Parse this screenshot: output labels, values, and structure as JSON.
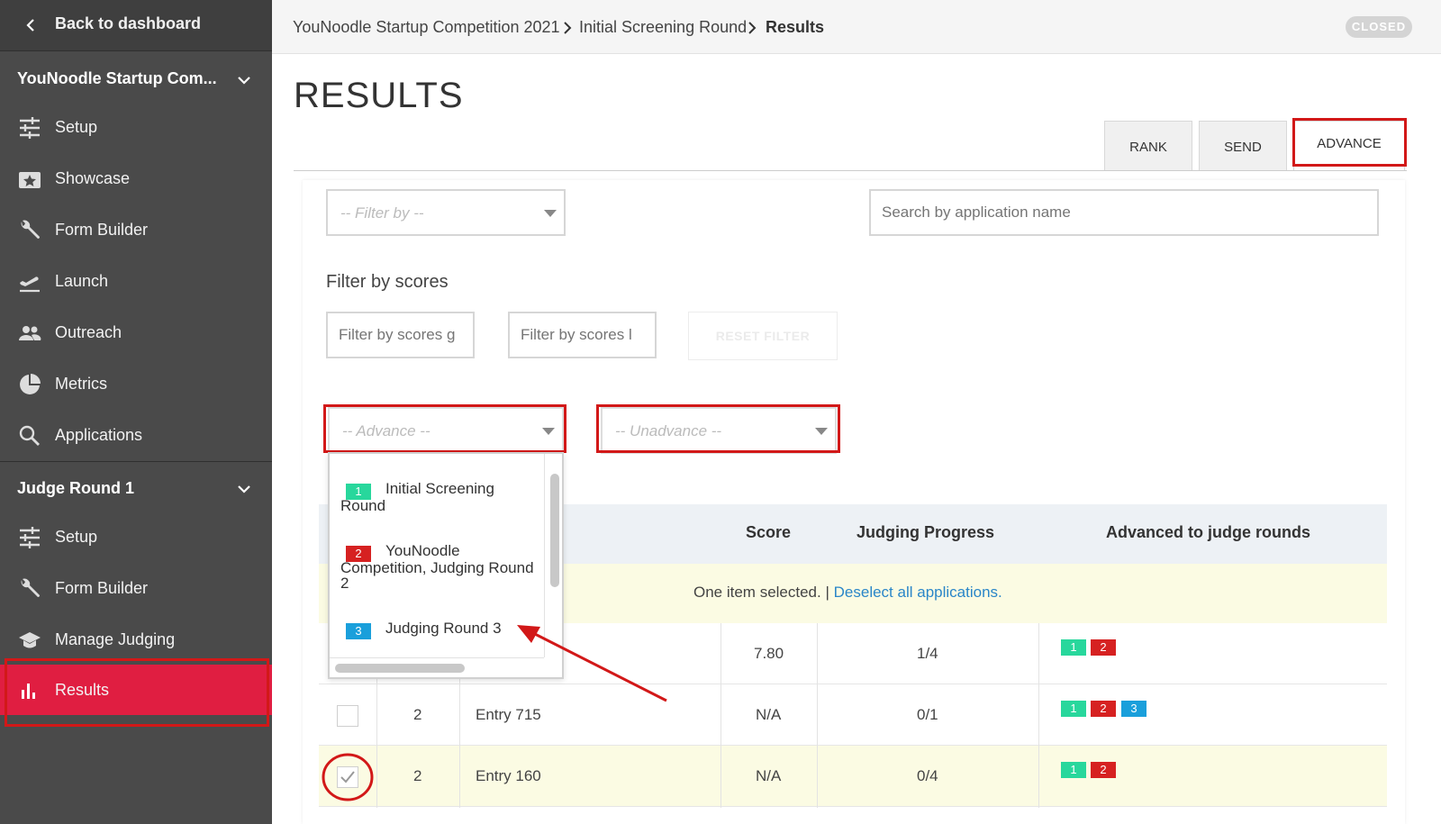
{
  "sidebar": {
    "back_label": "Back to dashboard",
    "program_title": "YouNoodle Startup Com...",
    "program_items": [
      {
        "label": "Setup",
        "icon": "sliders-icon"
      },
      {
        "label": "Showcase",
        "icon": "star-card-icon"
      },
      {
        "label": "Form Builder",
        "icon": "wrench-icon"
      },
      {
        "label": "Launch",
        "icon": "plane-takeoff-icon"
      },
      {
        "label": "Outreach",
        "icon": "people-icon"
      },
      {
        "label": "Metrics",
        "icon": "pie-chart-icon"
      },
      {
        "label": "Applications",
        "icon": "search-icon"
      }
    ],
    "round_title": "Judge Round 1",
    "round_items": [
      {
        "label": "Setup",
        "icon": "sliders-icon"
      },
      {
        "label": "Form Builder",
        "icon": "wrench-icon"
      },
      {
        "label": "Manage Judging",
        "icon": "graduation-cap-icon"
      },
      {
        "label": "Results",
        "icon": "bar-chart-icon",
        "active": true
      }
    ]
  },
  "breadcrumb": {
    "items": [
      "YouNoodle Startup Competition 2021",
      "Initial Screening Round",
      "Results"
    ],
    "status": "CLOSED"
  },
  "page": {
    "title": "RESULTS",
    "tabs": [
      "RANK",
      "SEND",
      "ADVANCE"
    ],
    "active_tab": "ADVANCE"
  },
  "filters": {
    "filter_by_placeholder": "-- Filter by --",
    "search_placeholder": "Search by application name",
    "scores_label": "Filter by scores",
    "scores_gt_placeholder": "Filter by scores g",
    "scores_lt_placeholder": "Filter by scores l",
    "reset_label": "RESET FILTER",
    "advance_placeholder": "-- Advance --",
    "unadvance_placeholder": "-- Unadvance --"
  },
  "advance_dropdown": {
    "options": [
      {
        "badge": "1",
        "label": "Initial Screening Round"
      },
      {
        "badge": "2",
        "label": "YouNoodle Competition, Judging Round 2"
      },
      {
        "badge": "3",
        "label": "Judging Round 3"
      }
    ]
  },
  "table": {
    "columns": [
      "Score",
      "Judging Progress",
      "Advanced to judge rounds"
    ],
    "selection_text": "One item selected.",
    "selection_sep": "|",
    "deselect_link": "Deselect all applications.",
    "rows": [
      {
        "rank": "",
        "name": "",
        "score": "7.80",
        "progress": "1/4",
        "rounds": [
          "1",
          "2"
        ],
        "checked": false
      },
      {
        "rank": "2",
        "name": "Entry 715",
        "score": "N/A",
        "progress": "0/1",
        "rounds": [
          "1",
          "2",
          "3"
        ],
        "checked": false
      },
      {
        "rank": "2",
        "name": "Entry 160",
        "score": "N/A",
        "progress": "0/4",
        "rounds": [
          "1",
          "2"
        ],
        "checked": true
      }
    ]
  },
  "colors": {
    "sidebar_bg": "#4a4a4a",
    "active_item": "#e01e41",
    "annotation_red": "#d21818",
    "round1": "#28d79c",
    "round2": "#d62121",
    "round3": "#1a9fdb",
    "link": "#2a86c8"
  }
}
